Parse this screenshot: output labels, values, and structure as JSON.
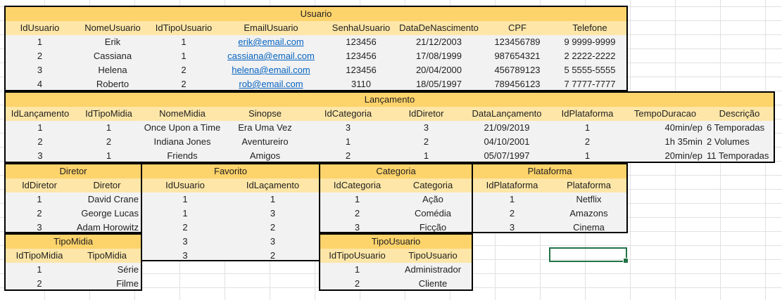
{
  "usuario": {
    "title": "Usuario",
    "columns": [
      "IdUsuario",
      "NomeUsuario",
      "IdTipoUsuario",
      "EmailUsuario",
      "SenhaUsuario",
      "DataDeNascimento",
      "CPF",
      "Telefone"
    ],
    "rows": [
      [
        "1",
        "Erik",
        "1",
        "erik@email.com",
        "123456",
        "21/12/2003",
        "123456789",
        "9 9999-9999"
      ],
      [
        "2",
        "Cassiana",
        "1",
        "cassiana@email.com",
        "123456",
        "17/08/1999",
        "987654321",
        "2 2222-2222"
      ],
      [
        "3",
        "Helena",
        "2",
        "helena@email.com",
        "123456",
        "20/04/2000",
        "456789123",
        "5 5555-5555"
      ],
      [
        "4",
        "Roberto",
        "2",
        "rob@email.com",
        "3110",
        "18/05/1997",
        "789456123",
        "7 7777-7777"
      ]
    ]
  },
  "lancamento": {
    "title": "Lançamento",
    "columns": [
      "IdLançamento",
      "IdTipoMidia",
      "NomeMidia",
      "Sinopse",
      "IdCategoria",
      "IdDiretor",
      "DataLançamento",
      "IdPlataforma",
      "TempoDuracao",
      "Descrição"
    ],
    "rows": [
      [
        "1",
        "1",
        "Once Upon a Time",
        "Era Uma Vez",
        "3",
        "3",
        "21/09/2019",
        "1",
        "40min/ep",
        "6 Temporadas"
      ],
      [
        "2",
        "2",
        "Indiana Jones",
        "Aventureiro",
        "1",
        "2",
        "04/10/2001",
        "2",
        "1h 35min",
        "2 Volumes"
      ],
      [
        "3",
        "1",
        "Friends",
        "Amigos",
        "2",
        "1",
        "05/07/1997",
        "1",
        "20min/ep",
        "11 Temporadas"
      ]
    ]
  },
  "diretor": {
    "title": "Diretor",
    "columns": [
      "IdDiretor",
      "Diretor"
    ],
    "rows": [
      [
        "1",
        "David Crane"
      ],
      [
        "2",
        "George Lucas"
      ],
      [
        "3",
        "Adam Horowitz"
      ]
    ]
  },
  "favorito": {
    "title": "Favorito",
    "columns": [
      "IdUsuario",
      "IdLaçamento"
    ],
    "rows": [
      [
        "1",
        "1"
      ],
      [
        "1",
        "3"
      ],
      [
        "2",
        "2"
      ],
      [
        "3",
        "3"
      ],
      [
        "3",
        "2"
      ]
    ]
  },
  "categoria": {
    "title": "Categoria",
    "columns": [
      "IdCategoria",
      "Categoria"
    ],
    "rows": [
      [
        "1",
        "Ação"
      ],
      [
        "2",
        "Comédia"
      ],
      [
        "3",
        "Ficção"
      ]
    ]
  },
  "plataforma": {
    "title": "Plataforma",
    "columns": [
      "IdPlataforma",
      "Plataforma"
    ],
    "rows": [
      [
        "1",
        "Netflix"
      ],
      [
        "2",
        "Amazons"
      ],
      [
        "3",
        "Cinema"
      ]
    ]
  },
  "tipomidia": {
    "title": "TipoMidia",
    "columns": [
      "IdTipoMidia",
      "TipoMidia"
    ],
    "rows": [
      [
        "1",
        "Série"
      ],
      [
        "2",
        "Filme"
      ]
    ]
  },
  "tipousuario": {
    "title": "TipoUsuario",
    "columns": [
      "IdTipoUsuario",
      "TipoUsuario"
    ],
    "rows": [
      [
        "1",
        "Administrador"
      ],
      [
        "2",
        "Cliente"
      ]
    ]
  },
  "colors": {
    "title_fill": "#fdd36b",
    "header_fill": "#fde6a7",
    "body_fill": "#f2f2f2",
    "link": "#0563c1",
    "selection": "#217346"
  }
}
